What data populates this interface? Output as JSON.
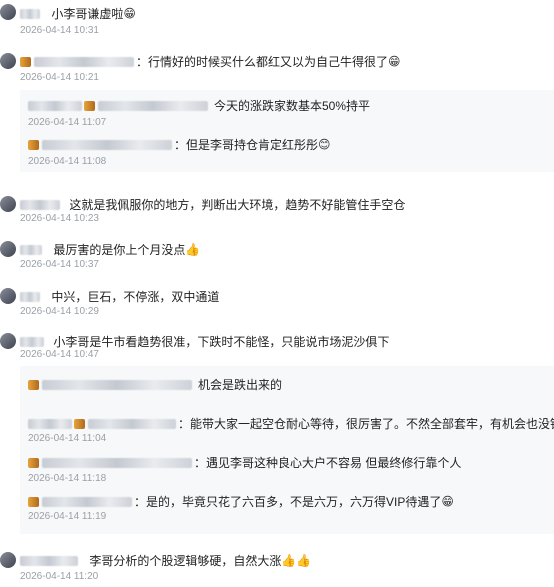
{
  "comments": [
    {
      "text": "小李哥谦虚啦",
      "emoji": "😁",
      "time": "2026-04-14 10:31"
    },
    {
      "text": "：行情好的时候买什么都红又以为自己牛得很了",
      "emoji": "😁",
      "time": "2026-04-14 10:21",
      "replies": [
        {
          "text": "今天的涨跌家数基本50%持平",
          "time": "2026-04-14 11:07"
        },
        {
          "text": "：但是李哥持仓肯定红彤彤",
          "emoji": "😊",
          "time": "2026-04-14 11:08"
        }
      ]
    },
    {
      "text": "这就是我佩服你的地方，判断出大环境，趋势不好能管住手空仓",
      "time": "2026-04-14 10:23"
    },
    {
      "text": "最厉害的是你上个月没点",
      "emoji": "👍",
      "time": "2026-04-14 10:37"
    },
    {
      "text": "中兴，巨石，不停涨，双中通道",
      "time": "2026-04-14 10:29"
    },
    {
      "text": "小李哥是牛市看趋势很准，下跌时不能怪，只能说市场泥沙俱下",
      "time": "2026-04-14 10:47",
      "replies": [
        {
          "text": "机会是跌出来的",
          "time": ""
        },
        {
          "text": "：能带大家一起空仓耐心等待，很厉害了。不然全部套牢，有机会也没钱",
          "emoji": "👍",
          "time": "2026-04-14 11:04"
        },
        {
          "text": "：遇见李哥这种良心大户不容易 但最终修行靠个人",
          "time": "2026-04-14 11:18"
        },
        {
          "text": "：是的，毕竟只花了六百多，不是六万，六万得VIP待遇了",
          "emoji": "😁",
          "time": "2026-04-14 11:19"
        }
      ]
    },
    {
      "text": "李哥分析的个股逻辑够硬，自然大涨",
      "emoji": "👍👍",
      "time": "2026-04-14 11:20"
    }
  ]
}
